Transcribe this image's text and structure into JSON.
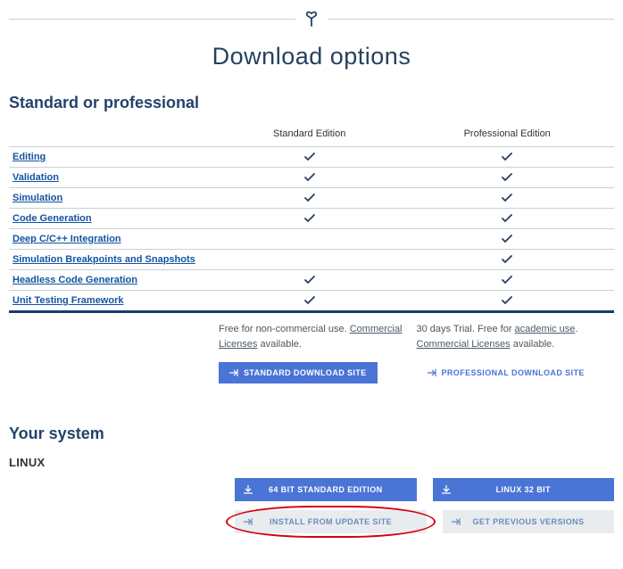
{
  "page": {
    "title": "Download options"
  },
  "sections": {
    "compare_title": "Standard or professional",
    "system_title": "Your system",
    "os_label": "LINUX"
  },
  "columns": {
    "standard_header": "Standard Edition",
    "professional_header": "Professional Edition"
  },
  "features": [
    {
      "name": "Editing",
      "std": true,
      "pro": true
    },
    {
      "name": "Validation",
      "std": true,
      "pro": true
    },
    {
      "name": "Simulation",
      "std": true,
      "pro": true
    },
    {
      "name": "Code Generation",
      "std": true,
      "pro": true
    },
    {
      "name": "Deep C/C++ Integration",
      "std": false,
      "pro": true
    },
    {
      "name": "Simulation Breakpoints and Snapshots",
      "std": false,
      "pro": true
    },
    {
      "name": "Headless Code Generation",
      "std": true,
      "pro": true
    },
    {
      "name": "Unit Testing Framework",
      "std": true,
      "pro": true
    }
  ],
  "blurbs": {
    "std_prefix": "Free for non-commercial use. ",
    "std_link": "Commercial Licenses",
    "std_suffix": " available.",
    "pro_prefix": "30 days Trial. Free for ",
    "pro_link1": "academic use",
    "pro_mid": ". ",
    "pro_link2": "Commercial Licenses",
    "pro_suffix": " available."
  },
  "buttons": {
    "std_site": "Standard Download Site",
    "pro_site": "Professional Download Site",
    "linux64": "64 Bit Standard Edition",
    "linux32": "Linux 32 Bit",
    "install_update": "Install From Update Site",
    "prev_versions": "Get Previous Versions"
  }
}
